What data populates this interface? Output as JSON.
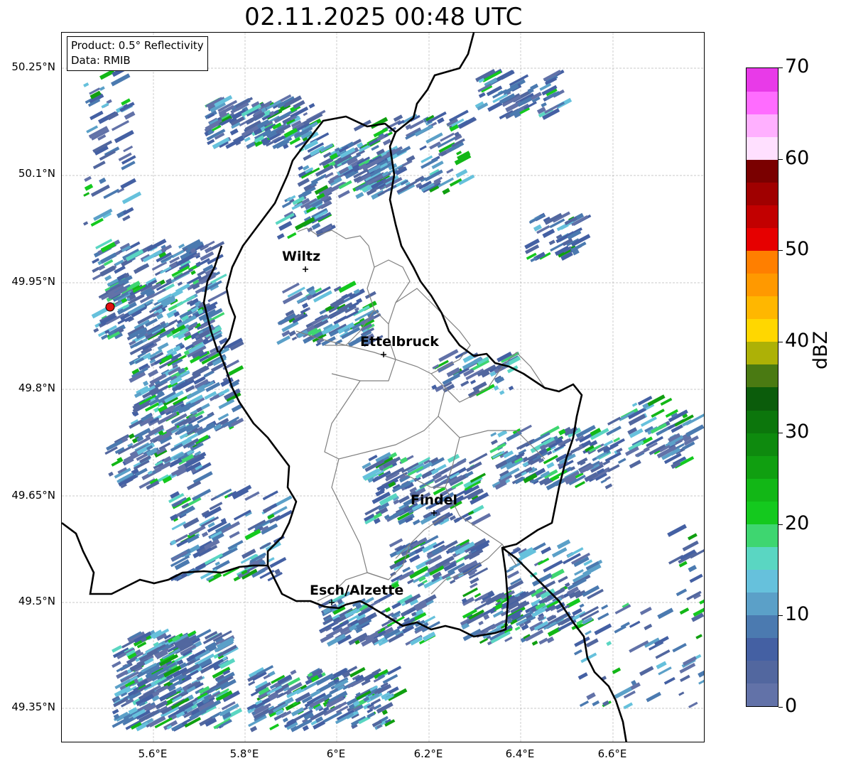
{
  "title": "02.11.2025 00:48 UTC",
  "info": {
    "product": "Product: 0.5° Reflectivity",
    "data": "Data: RMIB"
  },
  "lat_labels": [
    "50.25°N",
    "50.1°N",
    "49.95°N",
    "49.8°N",
    "49.65°N",
    "49.5°N",
    "49.35°N"
  ],
  "lon_labels": [
    "5.6°E",
    "5.8°E",
    "6°E",
    "6.2°E",
    "6.4°E",
    "6.6°E"
  ],
  "cities": [
    "Wiltz",
    "Ettelbruck",
    "Findel",
    "Esch/Alzette"
  ],
  "colorbar": {
    "label": "dBZ",
    "ticks": [
      "0",
      "10",
      "20",
      "30",
      "40",
      "50",
      "60",
      "70"
    ],
    "colors": [
      "#6272a8",
      "#52679f",
      "#4460a3",
      "#4b7ab0",
      "#5ba0c8",
      "#66c1dc",
      "#5ad6c2",
      "#3ed670",
      "#14c91e",
      "#12b716",
      "#109f10",
      "#0e8a0e",
      "#0c760c",
      "#0b5c0b",
      "#4a7a12",
      "#adb106",
      "#ffd700",
      "#ffb700",
      "#ff9900",
      "#ff7f00",
      "#e60000",
      "#c20000",
      "#a00000",
      "#7a0000",
      "#ffe0ff",
      "#ffb0ff",
      "#ff6cff",
      "#e83ae8"
    ]
  },
  "colors": {
    "border": "#000000",
    "canton": "#808080",
    "grid": "#b8b8b8",
    "radar_site": "#e01010"
  }
}
